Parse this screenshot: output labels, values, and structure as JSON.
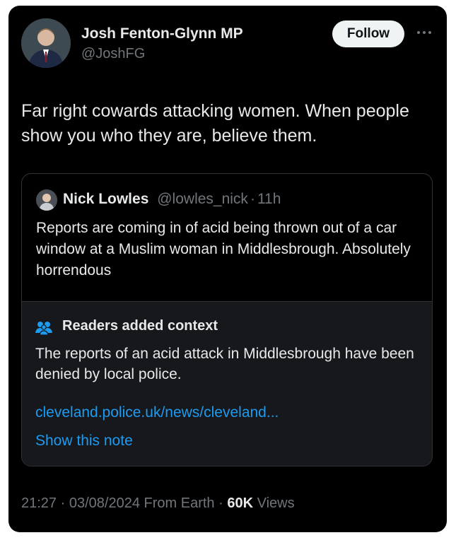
{
  "tweet": {
    "author_name": "Josh Fenton-Glynn MP",
    "author_handle": "@JoshFG",
    "follow_label": "Follow",
    "text": "Far right cowards attacking women. When people show you who they are, believe them."
  },
  "quoted": {
    "author_name": "Nick Lowles",
    "author_handle": "@lowles_nick",
    "separator": "·",
    "time": "11h",
    "text": "Reports are coming in of acid being thrown out of a car window at a Muslim woman in Middlesbrough. Absolutely horrendous"
  },
  "note": {
    "icon": "people-icon",
    "title": "Readers added context",
    "text": "The reports of an acid attack in Middlesbrough have been denied by local police.",
    "link": "cleveland.police.uk/news/cleveland...",
    "show_label": "Show this note"
  },
  "footer": {
    "time": "21:27",
    "sep1": "·",
    "date": "03/08/2024",
    "source": "From Earth",
    "sep2": "·",
    "views_count": "60K",
    "views_label": "Views"
  },
  "colors": {
    "background": "#000000",
    "text": "#e7e9ea",
    "muted": "#71767b",
    "link": "#1d9bf0",
    "note_bg": "#16181c"
  }
}
